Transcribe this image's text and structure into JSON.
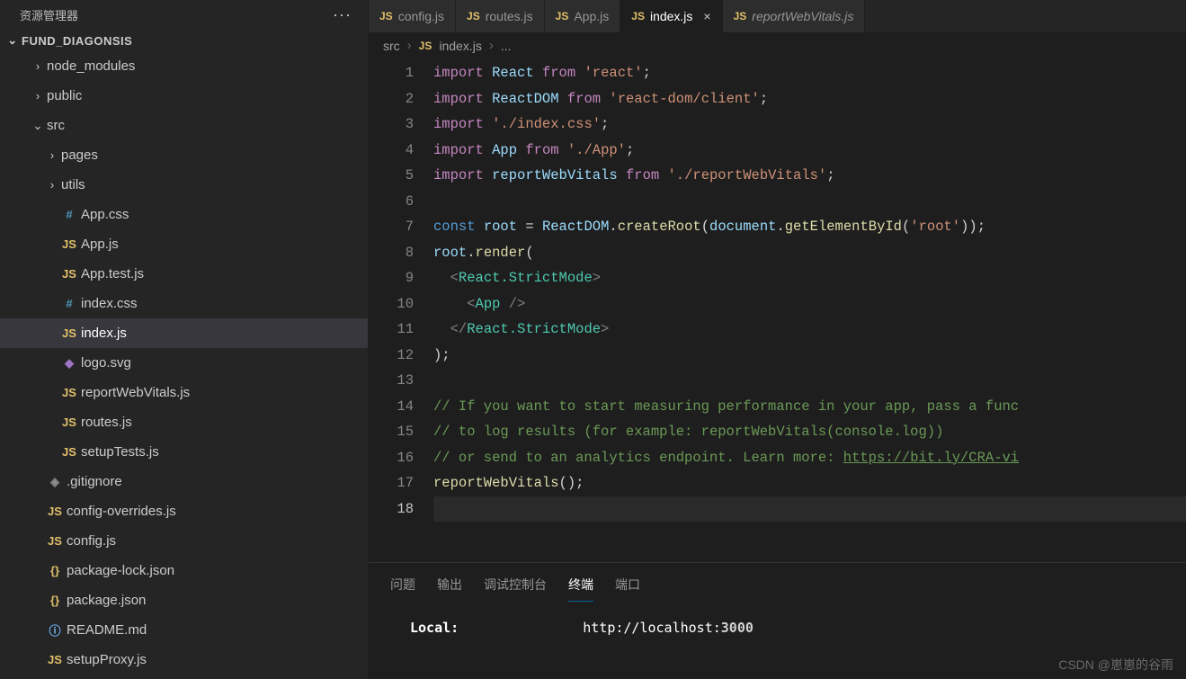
{
  "explorer": {
    "title": "资源管理器",
    "more_icon": "···",
    "project": "FUND_DIAGONSIS",
    "tree": [
      {
        "label": "node_modules",
        "type": "folder",
        "open": false,
        "indent": 1
      },
      {
        "label": "public",
        "type": "folder",
        "open": false,
        "indent": 1
      },
      {
        "label": "src",
        "type": "folder",
        "open": true,
        "indent": 1
      },
      {
        "label": "pages",
        "type": "folder",
        "open": false,
        "indent": 2
      },
      {
        "label": "utils",
        "type": "folder",
        "open": false,
        "indent": 2
      },
      {
        "label": "App.css",
        "type": "css",
        "indent": 2
      },
      {
        "label": "App.js",
        "type": "js",
        "indent": 2
      },
      {
        "label": "App.test.js",
        "type": "js",
        "indent": 2
      },
      {
        "label": "index.css",
        "type": "css",
        "indent": 2
      },
      {
        "label": "index.js",
        "type": "js",
        "indent": 2,
        "selected": true
      },
      {
        "label": "logo.svg",
        "type": "svg",
        "indent": 2
      },
      {
        "label": "reportWebVitals.js",
        "type": "js",
        "indent": 2
      },
      {
        "label": "routes.js",
        "type": "js",
        "indent": 2
      },
      {
        "label": "setupTests.js",
        "type": "js",
        "indent": 2
      },
      {
        "label": ".gitignore",
        "type": "git",
        "indent": 1
      },
      {
        "label": "config-overrides.js",
        "type": "js",
        "indent": 1
      },
      {
        "label": "config.js",
        "type": "js",
        "indent": 1
      },
      {
        "label": "package-lock.json",
        "type": "json",
        "indent": 1
      },
      {
        "label": "package.json",
        "type": "json",
        "indent": 1
      },
      {
        "label": "README.md",
        "type": "info",
        "indent": 1
      },
      {
        "label": "setupProxy.js",
        "type": "js",
        "indent": 1
      }
    ]
  },
  "tabs": [
    {
      "label": "config.js",
      "active": false
    },
    {
      "label": "routes.js",
      "active": false
    },
    {
      "label": "App.js",
      "active": false
    },
    {
      "label": "index.js",
      "active": true,
      "closable": true
    },
    {
      "label": "reportWebVitals.js",
      "active": false,
      "italic": true
    }
  ],
  "breadcrumb": {
    "parts": [
      "src",
      "index.js",
      "..."
    ]
  },
  "code_lines": 18,
  "panel": {
    "tabs": [
      "问题",
      "输出",
      "调试控制台",
      "终端",
      "端口"
    ],
    "active": "终端",
    "terminal": {
      "label": "Local:",
      "url": "http://localhost:",
      "port": "3000"
    }
  },
  "watermark": "CSDN @崽崽的谷雨"
}
